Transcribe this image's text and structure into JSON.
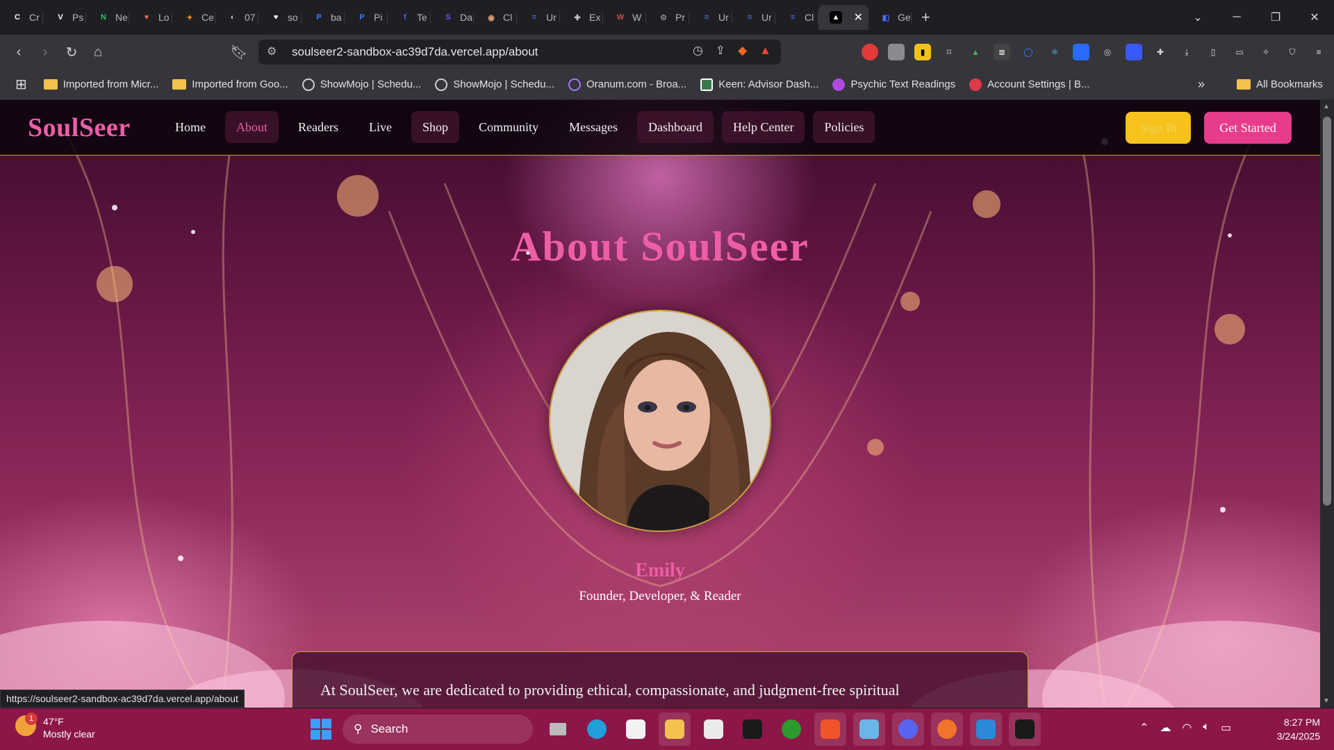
{
  "browser": {
    "tabs": [
      {
        "label": "Cr",
        "color": "#ffffff",
        "glyph": "C"
      },
      {
        "label": "Ps",
        "color": "#ffffff",
        "glyph": "V"
      },
      {
        "label": "Ne",
        "color": "#2fbf71",
        "glyph": "N"
      },
      {
        "label": "Lo",
        "color": "#f06a4a",
        "glyph": "♥"
      },
      {
        "label": "Ce",
        "color": "#f08a2a",
        "glyph": "✦"
      },
      {
        "label": "07",
        "color": "#bbbbbb",
        "glyph": "◐"
      },
      {
        "label": "so",
        "color": "#ffffff",
        "glyph": "♥"
      },
      {
        "label": "ba",
        "color": "#3a7dff",
        "glyph": "P"
      },
      {
        "label": "Pi",
        "color": "#3a7dff",
        "glyph": "P"
      },
      {
        "label": "Te",
        "color": "#3a6dff",
        "glyph": "f"
      },
      {
        "label": "Da",
        "color": "#7a4bff",
        "glyph": "S"
      },
      {
        "label": "Cl",
        "color": "#d9a07a",
        "glyph": "◉"
      },
      {
        "label": "Ur",
        "color": "#4a7dff",
        "glyph": "≡"
      },
      {
        "label": "Ex",
        "color": "#cccccc",
        "glyph": "✚"
      },
      {
        "label": "W",
        "color": "#d14a4a",
        "glyph": "W"
      },
      {
        "label": "Pr",
        "color": "#888888",
        "glyph": "⚙"
      },
      {
        "label": "Ur",
        "color": "#4a7dff",
        "glyph": "≡"
      },
      {
        "label": "Ur",
        "color": "#4a7dff",
        "glyph": "≡"
      },
      {
        "label": "Cl",
        "color": "#4a7dff",
        "glyph": "≡"
      }
    ],
    "active_tab_glyph": "▲",
    "after_tab": {
      "label": "Ge",
      "glyph": "◧",
      "color": "#4a6dff"
    },
    "url": "soulseer2-sandbox-ac39d7da.vercel.app/about",
    "bookmarks": [
      {
        "label": "Imported from Micr...",
        "icon": "folder-icon"
      },
      {
        "label": "Imported from Goo...",
        "icon": "folder-icon"
      },
      {
        "label": "ShowMojo | Schedu...",
        "icon": "globe-icon"
      },
      {
        "label": "ShowMojo | Schedu...",
        "icon": "globe-icon"
      },
      {
        "label": "Oranum.com - Broa...",
        "icon": "oranum-icon"
      },
      {
        "label": "Keen: Advisor Dash...",
        "icon": "keen-icon"
      },
      {
        "label": "Psychic Text Readings",
        "icon": "lotus-icon"
      },
      {
        "label": "Account Settings | B...",
        "icon": "heart-icon"
      }
    ],
    "all_bookmarks": "All Bookmarks",
    "status_url": "https://soulseer2-sandbox-ac39d7da.vercel.app/about"
  },
  "site": {
    "logo": "SoulSeer",
    "nav": [
      "Home",
      "About",
      "Readers",
      "Live",
      "Shop",
      "Community",
      "Messages",
      "Dashboard",
      "Help Center",
      "Policies"
    ],
    "current_nav": "About",
    "sign_in": "Sign In",
    "get_started": "Get Started",
    "title": "About SoulSeer",
    "name": "Emily",
    "role": "Founder, Developer, & Reader",
    "card_text": "At SoulSeer, we are dedicated to providing ethical, compassionate, and judgment-free spiritual",
    "colors": {
      "pink": "#ee5ea6",
      "gold": "#c9a23a",
      "cta": "#e73c8b",
      "signin": "#f7c21c"
    }
  },
  "taskbar": {
    "weather_temp": "47°F",
    "weather_desc": "Mostly clear",
    "weather_badge": "1",
    "search": "Search",
    "time": "8:27 PM",
    "date": "3/24/2025"
  }
}
